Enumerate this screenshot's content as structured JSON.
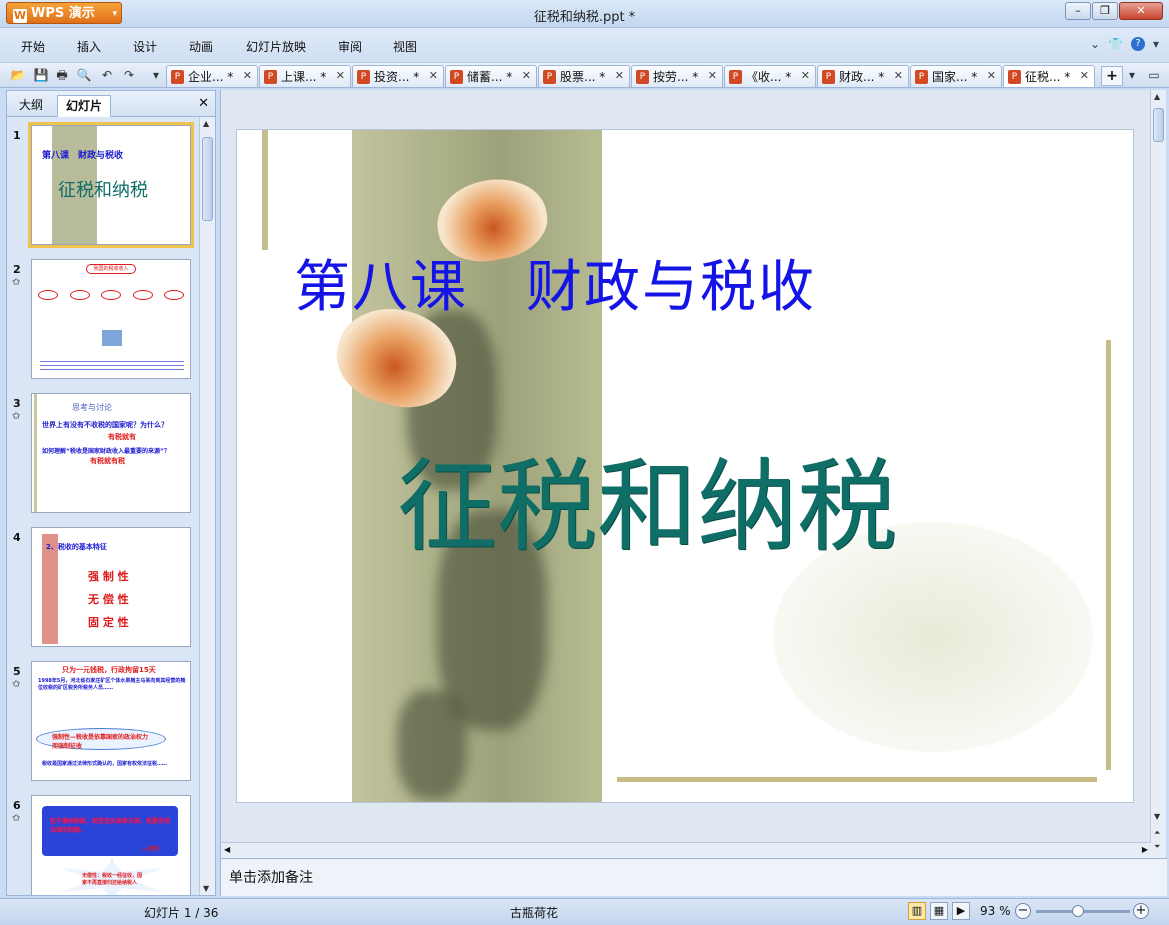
{
  "app": {
    "button_label": "WPS 演示",
    "window_title": "征税和纳税.ppt *"
  },
  "menu": [
    "开始",
    "插入",
    "设计",
    "动画",
    "幻灯片放映",
    "审阅",
    "视图"
  ],
  "doc_tabs": [
    {
      "label": "企业... *"
    },
    {
      "label": "上课... *"
    },
    {
      "label": "投资... *"
    },
    {
      "label": "储蓄... *"
    },
    {
      "label": "股票... *"
    },
    {
      "label": "按劳... *"
    },
    {
      "label": "《收... *"
    },
    {
      "label": "财政... *"
    },
    {
      "label": "国家... *"
    },
    {
      "label": "征税... *"
    }
  ],
  "left_pane": {
    "tab_outline": "大纲",
    "tab_slides": "幻灯片",
    "slides": [
      {
        "number": "1",
        "lines": [
          "第八课　财政与税收",
          "征税和纳税"
        ]
      },
      {
        "number": "2",
        "lines": [
          "我国的税收收入"
        ]
      },
      {
        "number": "3",
        "lines": [
          "思考与讨论",
          "世界上有没有不收税的国家呢？为什么？",
          "有税就有",
          "如何理解“税收是国家财政收入最重要的来源”？",
          "有税就有税"
        ]
      },
      {
        "number": "4",
        "lines": [
          "2、税收的基本特征",
          "强 制 性",
          "无 偿 性",
          "固 定 性"
        ]
      },
      {
        "number": "5",
        "lines": [
          "只为一元钱税，行政拘留15天",
          "1998年5月，河北省石家庄矿区个体水果摊主马某向到其经营的摊位收税的矿区税务所税务人员……",
          "强制性—税收是依靠国家的政治权力而强制征收",
          "税收是国家通过法律形式确认的，国家有权依法征税……"
        ]
      },
      {
        "number": "6",
        "lines": [
          "拒不缴纳税款，就是违反国家法律，就要受到法律的制裁。",
          "—列宁",
          "无偿性：税收一经征收，国家不再直接归还给纳税人"
        ]
      }
    ]
  },
  "slide": {
    "subtitle": "第八课　财政与税收",
    "title": "征税和纳税"
  },
  "notes_placeholder": "单击添加备注",
  "status": {
    "slide_counter": "幻灯片 1 / 36",
    "design_name": "古瓶荷花",
    "zoom": "93 %"
  }
}
